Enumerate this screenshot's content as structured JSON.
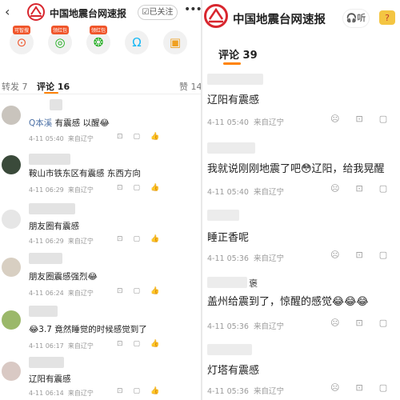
{
  "left": {
    "header": {
      "title": "中国地震台网速报",
      "follow_label": "☑已关注",
      "back_icon": "back-arrow-icon",
      "more_icon": "more-dots-icon"
    },
    "func_badges": [
      "可智搜",
      "领红包",
      "领红包"
    ],
    "tabs": {
      "repost": "转发 7",
      "comment": "评论 16",
      "like": "赞 14"
    },
    "comments": [
      {
        "prefix": "Q本溪",
        "text": "有震感 以醒😂",
        "time": "4-11 05:40",
        "location": "来自辽宁",
        "likes": ""
      },
      {
        "text": "鞍山市铁东区有震感 东西方向",
        "time": "4-11 06:29",
        "location": "来自辽宁"
      },
      {
        "text": "朋友圈有震感",
        "time": "4-11 06:29",
        "location": "来自辽宁"
      },
      {
        "text": "朋友圈震感强烈😂",
        "time": "4-11 06:24",
        "location": "来自辽宁"
      },
      {
        "text": "😂3.7 竟然睡觉的时候感觉到了",
        "time": "4-11 06:17",
        "location": "来自辽宁"
      },
      {
        "text": "辽阳有震感",
        "time": "4-11 06:14",
        "location": "来自辽宁"
      }
    ]
  },
  "right": {
    "header": {
      "title": "中国地震台网速报",
      "listen_label": "听",
      "tab_label": "评论 39"
    },
    "comments": [
      {
        "text": "辽阳有震感",
        "time": "4-11 05:40",
        "location": "来自辽宁"
      },
      {
        "text": "我就说刚刚地震了吧😳辽阳，给我晃醒",
        "time": "4-11 05:40",
        "location": "来自辽宁"
      },
      {
        "text": "睡正香呢",
        "time": "4-11 05:36",
        "location": "来自辽宁"
      },
      {
        "name_suffix": "褒",
        "text": "盖州给震到了，惊醒的感觉😂😂😂",
        "time": "4-11 05:36",
        "location": "来自辽宁"
      },
      {
        "text": "灯塔有震感",
        "time": "4-11 05:36",
        "location": "来自辽宁"
      }
    ]
  },
  "colors": {
    "accent": "#ff8200",
    "brand_red": "#d8262e",
    "badge": "#f0552a"
  }
}
